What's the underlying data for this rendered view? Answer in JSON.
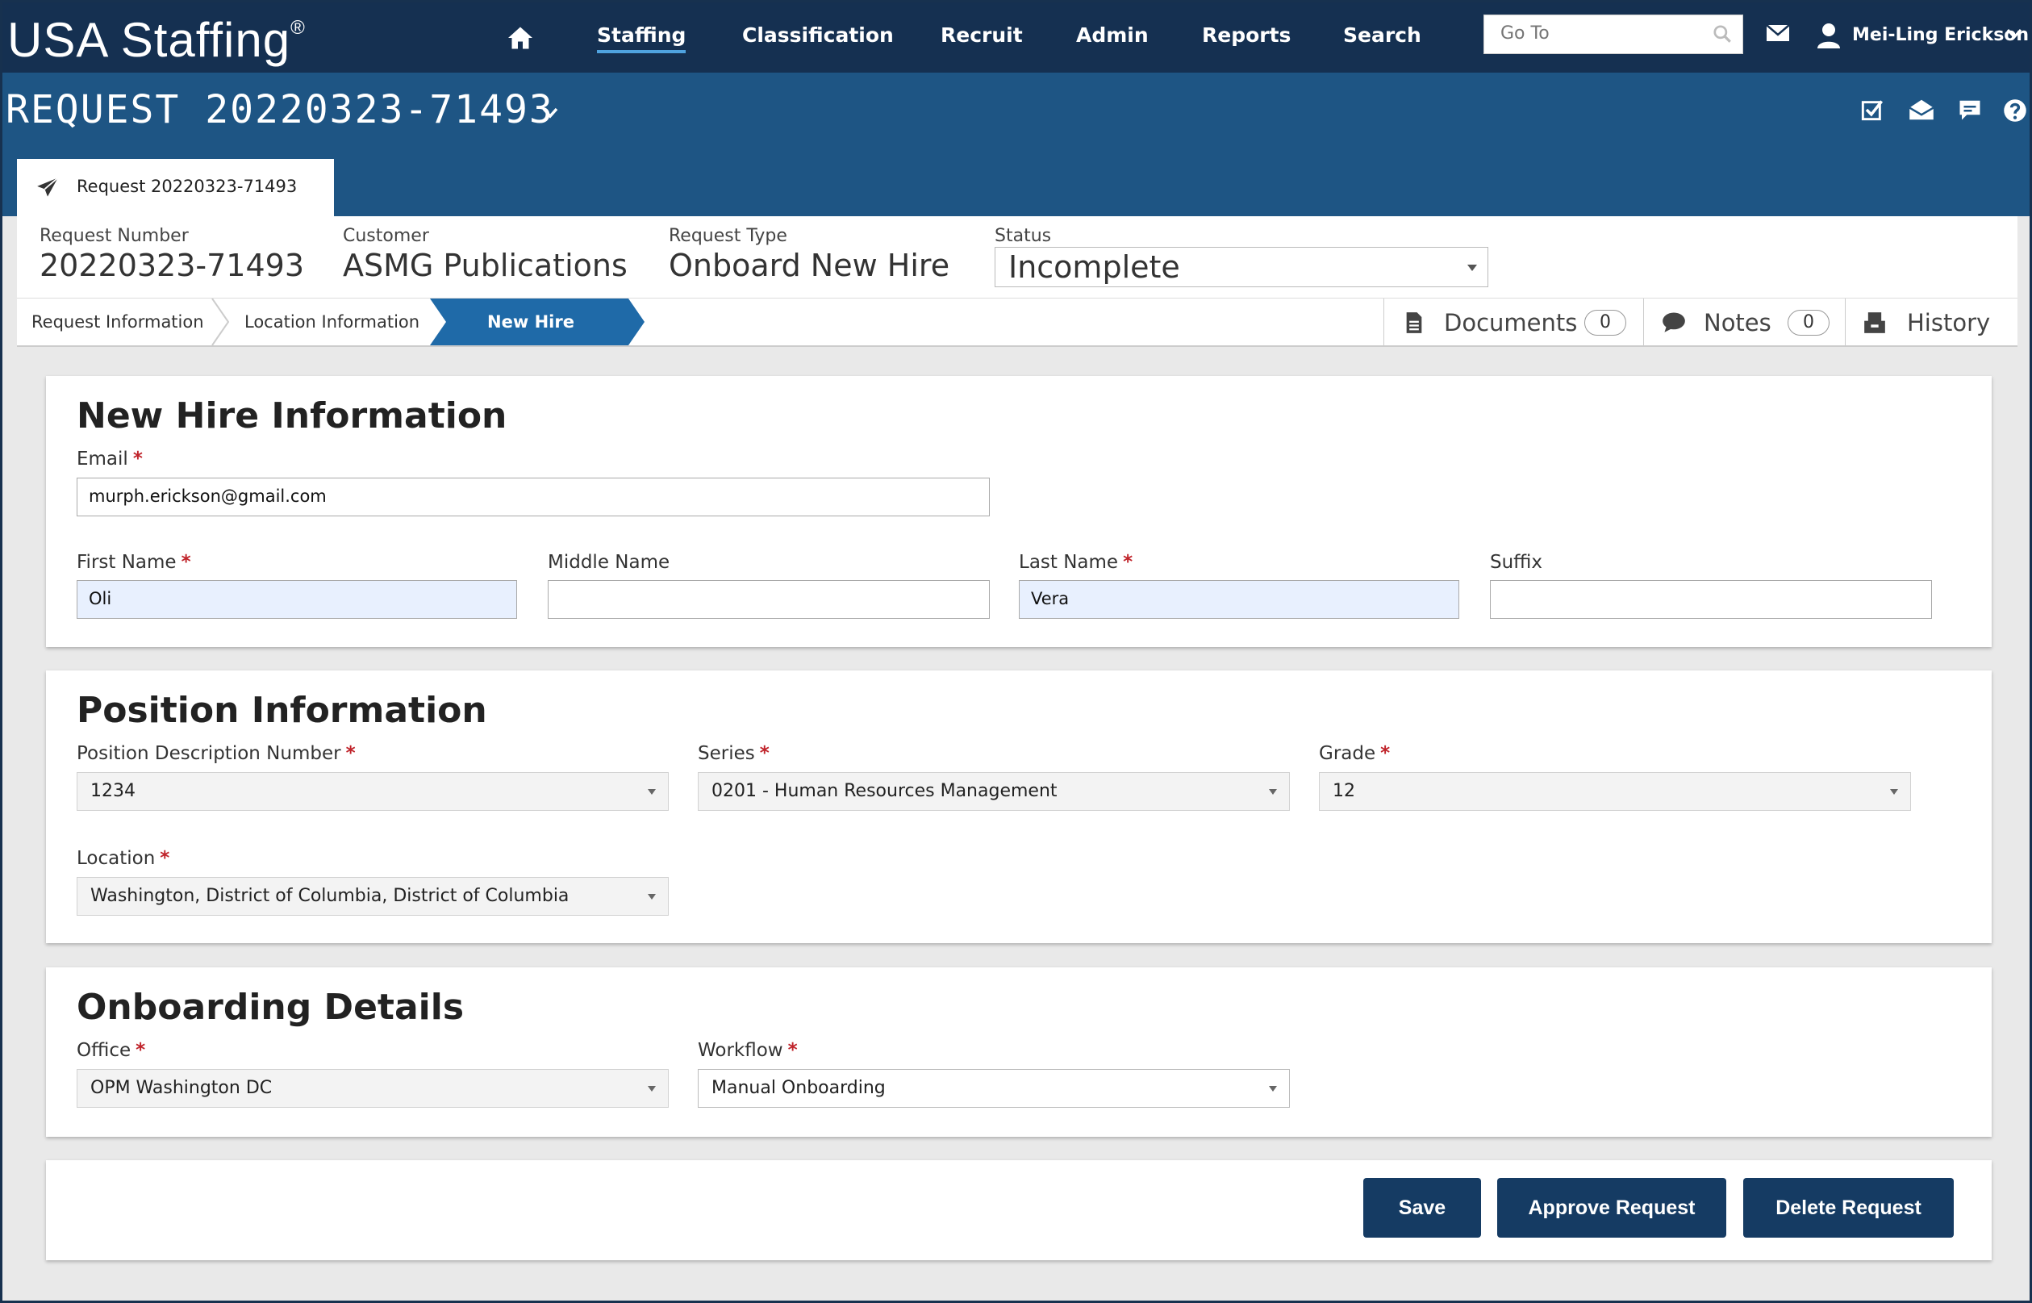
{
  "nav": {
    "brand": "USA Staffing",
    "brand_mark": "®",
    "items": [
      "Staffing",
      "Classification",
      "Recruit",
      "Admin",
      "Reports",
      "Search"
    ],
    "active_item": "Staffing",
    "goto_placeholder": "Go To",
    "user_name": "Mei-Ling Erickson"
  },
  "title": {
    "text": "REQUEST 20220323-71493",
    "tab_label": "Request 20220323-71493"
  },
  "summary": {
    "request_number_label": "Request Number",
    "request_number": "20220323-71493",
    "customer_label": "Customer",
    "customer": "ASMG Publications",
    "request_type_label": "Request Type",
    "request_type": "Onboard New Hire",
    "status_label": "Status",
    "status": "Incomplete"
  },
  "steps": {
    "step1": "Request Information",
    "step2": "Location Information",
    "step3": "New Hire"
  },
  "sidetabs": {
    "documents": "Documents",
    "documents_count": "0",
    "notes": "Notes",
    "notes_count": "0",
    "history": "History"
  },
  "new_hire": {
    "heading": "New Hire Information",
    "email_label": "Email",
    "email": "murph.erickson@gmail.com",
    "first_name_label": "First Name",
    "first_name": "Oli",
    "middle_name_label": "Middle Name",
    "middle_name": "",
    "last_name_label": "Last Name",
    "last_name": "Vera",
    "suffix_label": "Suffix",
    "suffix": ""
  },
  "position": {
    "heading": "Position Information",
    "pd_label": "Position Description Number",
    "pd": "1234",
    "series_label": "Series",
    "series": "0201 - Human Resources Management",
    "grade_label": "Grade",
    "grade": "12",
    "location_label": "Location",
    "location": "Washington, District of Columbia, District of Columbia"
  },
  "onboarding": {
    "heading": "Onboarding Details",
    "office_label": "Office",
    "office": "OPM Washington DC",
    "workflow_label": "Workflow",
    "workflow": "Manual Onboarding"
  },
  "actions": {
    "save": "Save",
    "approve": "Approve Request",
    "delete": "Delete Request"
  },
  "required_mark": "*",
  "colors": {
    "nav_bg": "#153051",
    "title_bg": "#1e5584",
    "active_step": "#1f6aa8",
    "button": "#153b63",
    "required": "#c0242b"
  }
}
